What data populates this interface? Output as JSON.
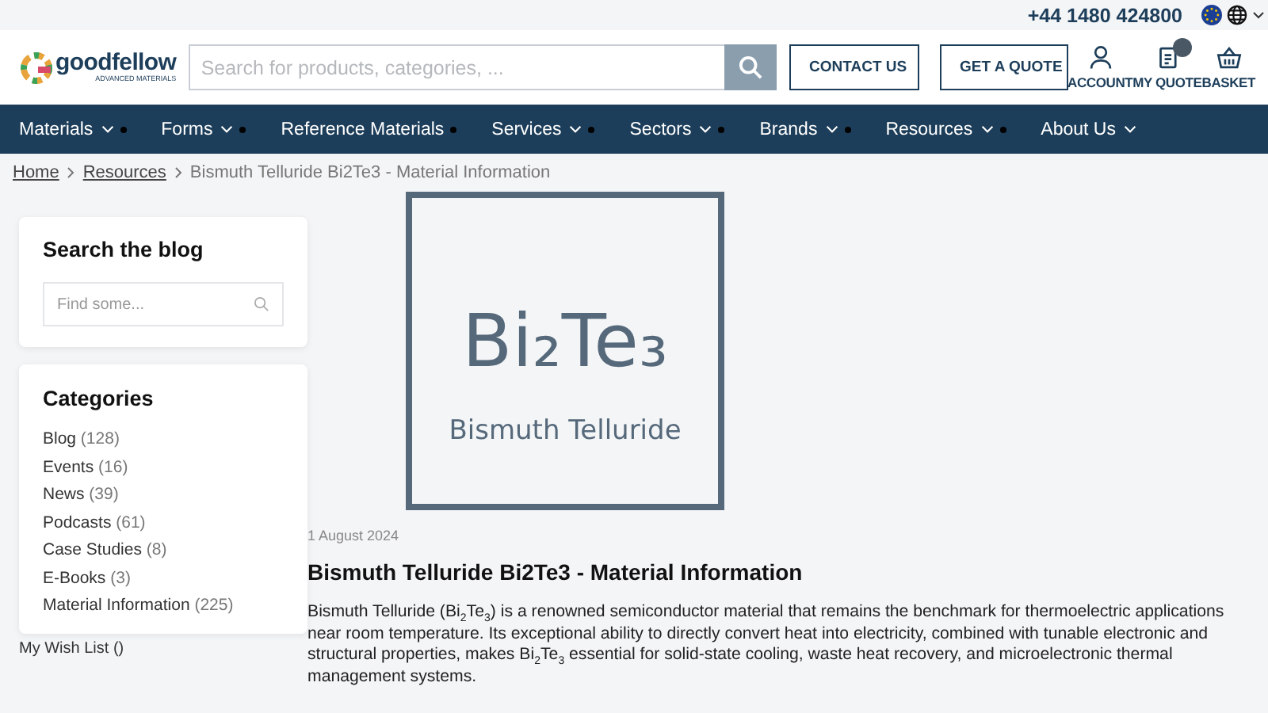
{
  "topbar": {
    "phone": "+44 1480 424800"
  },
  "header": {
    "logo_name": "goodfellow",
    "logo_tagline": "ADVANCED MATERIALS",
    "search": {
      "placeholder": "Search for products, categories, ..."
    },
    "buttons": [
      "CONTACT US",
      "GET A QUOTE"
    ],
    "actions": [
      {
        "kind": "account",
        "label": "ACCOUNT",
        "badge": false
      },
      {
        "kind": "quote",
        "label": "MY QUOTE",
        "badge": true
      },
      {
        "kind": "basket",
        "label": "BASKET",
        "badge": false
      }
    ]
  },
  "nav": [
    {
      "label": "Materials",
      "dropdown": true,
      "marker": true
    },
    {
      "label": "Forms",
      "dropdown": true,
      "marker": true
    },
    {
      "label": "Reference Materials",
      "dropdown": false,
      "marker": true
    },
    {
      "label": "Services",
      "dropdown": true,
      "marker": true
    },
    {
      "label": "Sectors",
      "dropdown": true,
      "marker": true
    },
    {
      "label": "Brands",
      "dropdown": true,
      "marker": true
    },
    {
      "label": "Resources",
      "dropdown": true,
      "marker": true
    },
    {
      "label": "About Us",
      "dropdown": true,
      "marker": false
    }
  ],
  "breadcrumb": [
    {
      "label": "Home",
      "link": true
    },
    {
      "label": "Resources",
      "link": true
    },
    {
      "label": "Bismuth Telluride Bi2Te3 - Material Information",
      "link": false
    }
  ],
  "sidebar": {
    "search": {
      "title": "Search the blog",
      "placeholder": "Find some..."
    },
    "categories": {
      "title": "Categories",
      "items": [
        {
          "name": "Blog",
          "count": "(128)"
        },
        {
          "name": "Events",
          "count": "(16)"
        },
        {
          "name": "News",
          "count": "(39)"
        },
        {
          "name": "Podcasts",
          "count": "(61)"
        },
        {
          "name": "Case Studies",
          "count": "(8)"
        },
        {
          "name": "E-Books",
          "count": "(3)"
        },
        {
          "name": "Material Information",
          "count": "(225)"
        }
      ]
    },
    "wishlist": "My Wish List ()"
  },
  "article": {
    "image": {
      "formula": "Bi₂Te₃",
      "caption": "Bismuth Telluride"
    },
    "date": "1 August 2024",
    "title": "Bismuth Telluride Bi2Te3 - Material Information",
    "body": "Bismuth Telluride (Bi$_{2}$Te$_{3}$) is a renowned semiconductor material that remains the benchmark for thermoelectric applications near room temperature. Its exceptional ability to directly convert heat into electricity, combined with tunable electronic and structural properties, makes Bi$_{2}$Te$_{3}$ essential for solid-state cooling, waste heat recovery, and microelectronic thermal management systems."
  }
}
